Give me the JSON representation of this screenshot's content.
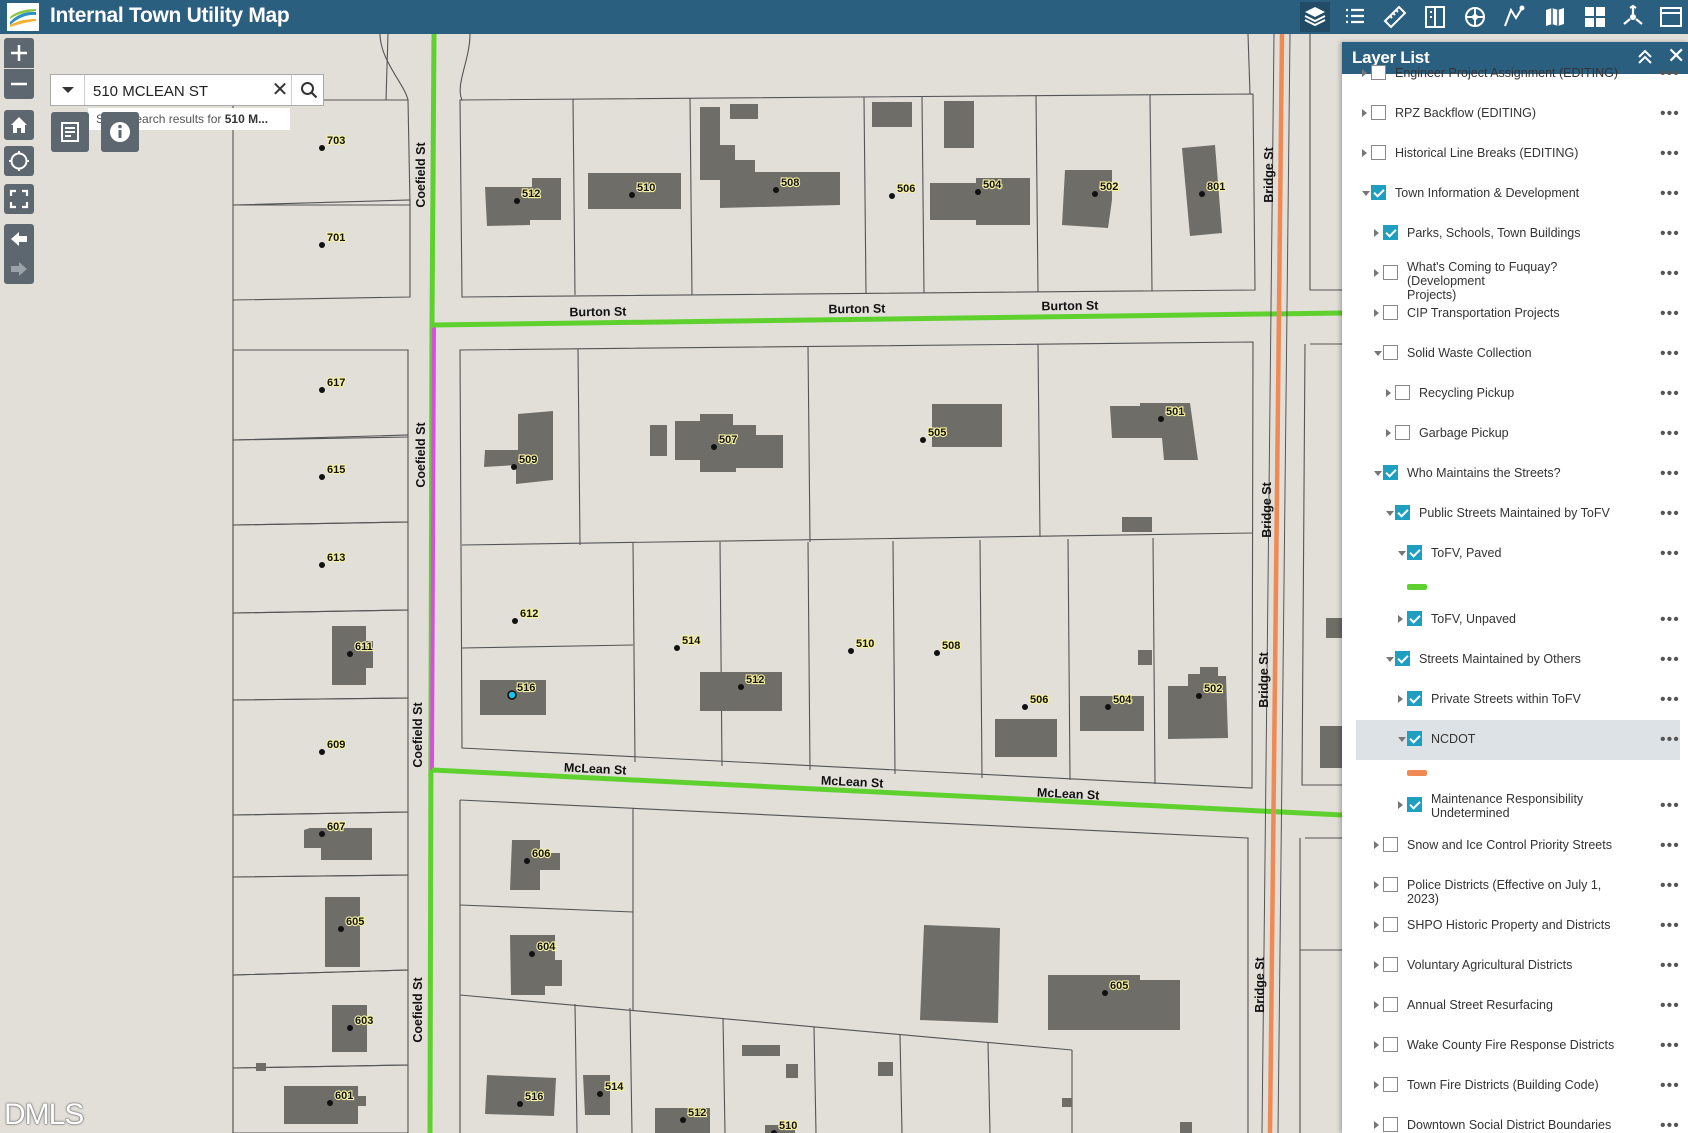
{
  "app": {
    "title": "Internal Town Utility Map"
  },
  "search": {
    "value": "510 MCLEAN ST",
    "hint_prefix": "Show search results for ",
    "hint_bold": "510 M...",
    "clear_glyph": "✕"
  },
  "watermark": "DMLS",
  "toolbar": [
    "layer-list-icon",
    "legend-icon",
    "measure-icon",
    "print-icon",
    "basemap-icon",
    "draw-icon",
    "edit-icon",
    "bookmark-icon",
    "grid-icon",
    "share-icon",
    "window-icon"
  ],
  "map": {
    "streets": [
      {
        "name": "Coefield St",
        "labels": [
          "Coefield St",
          "Coefield St",
          "Coefield St",
          "Coefield St"
        ]
      },
      {
        "name": "Burton St",
        "labels": [
          "Burton St",
          "Burton St",
          "Burton St"
        ]
      },
      {
        "name": "McLean St",
        "labels": [
          "McLean St",
          "McLean St",
          "McLean St"
        ]
      },
      {
        "name": "Bridge St",
        "labels": [
          "Bridge St",
          "Bridge St",
          "Bridge St",
          "Bridge St"
        ]
      }
    ],
    "address_labels": [
      "703",
      "701",
      "617",
      "615",
      "613",
      "611",
      "609",
      "607",
      "605",
      "603",
      "601",
      "512",
      "510",
      "508",
      "506",
      "504",
      "502",
      "801",
      "509",
      "507",
      "505",
      "501",
      "612",
      "514",
      "510",
      "508",
      "516",
      "512",
      "506",
      "504",
      "502",
      "606",
      "604",
      "605",
      "516",
      "514",
      "512",
      "510"
    ],
    "selected_address": "510",
    "colors": {
      "street_tofv_paved": "#5fd12e",
      "street_private": "#d84fe0",
      "street_ncdot": "#f08a55",
      "parcel_line": "#555555",
      "building": "#6e6d68",
      "background": "#e1dfd8",
      "header": "#2b5f80"
    }
  },
  "layer_list": {
    "title": "Layer List",
    "close_glyph": "✕",
    "more_glyph": "•••",
    "items": [
      {
        "label": "Engineer Project Assignment (EDITING)",
        "checked": false
      },
      {
        "label": "RPZ Backflow (EDITING)",
        "checked": false
      },
      {
        "label": "Historical Line Breaks (EDITING)",
        "checked": false
      },
      {
        "label": "Town Information & Development",
        "checked": true
      },
      {
        "label": "Parks, Schools, Town Buildings",
        "checked": true
      },
      {
        "label": "What's Coming to Fuquay? (Development",
        "label2": "Projects)",
        "checked": false
      },
      {
        "label": "CIP Transportation Projects",
        "checked": false
      },
      {
        "label": "Solid Waste Collection",
        "checked": false
      },
      {
        "label": "Recycling Pickup",
        "checked": false
      },
      {
        "label": "Garbage Pickup",
        "checked": false
      },
      {
        "label": "Who Maintains the Streets?",
        "checked": true
      },
      {
        "label": "Public Streets Maintained by ToFV",
        "checked": true
      },
      {
        "label": "ToFV, Paved",
        "checked": true,
        "swatch": "#5fd12e"
      },
      {
        "label": "ToFV, Unpaved",
        "checked": true
      },
      {
        "label": "Streets Maintained by Others",
        "checked": true
      },
      {
        "label": "Private Streets within ToFV",
        "checked": true
      },
      {
        "label": "NCDOT",
        "checked": true,
        "selected": true,
        "swatch": "#f08a55"
      },
      {
        "label": "Maintenance Responsibility",
        "label2": "Undetermined",
        "checked": true
      },
      {
        "label": "Snow and Ice Control Priority Streets",
        "checked": false
      },
      {
        "label": "Police Districts (Effective on July 1, 2023)",
        "checked": false
      },
      {
        "label": "SHPO Historic Property and Districts",
        "checked": false
      },
      {
        "label": "Voluntary Agricultural Districts",
        "checked": false
      },
      {
        "label": "Annual Street Resurfacing",
        "checked": false
      },
      {
        "label": "Wake County Fire Response Districts",
        "checked": false
      },
      {
        "label": "Town Fire Districts (Building Code)",
        "checked": false
      },
      {
        "label": "Downtown Social District Boundaries",
        "checked": false
      }
    ]
  }
}
